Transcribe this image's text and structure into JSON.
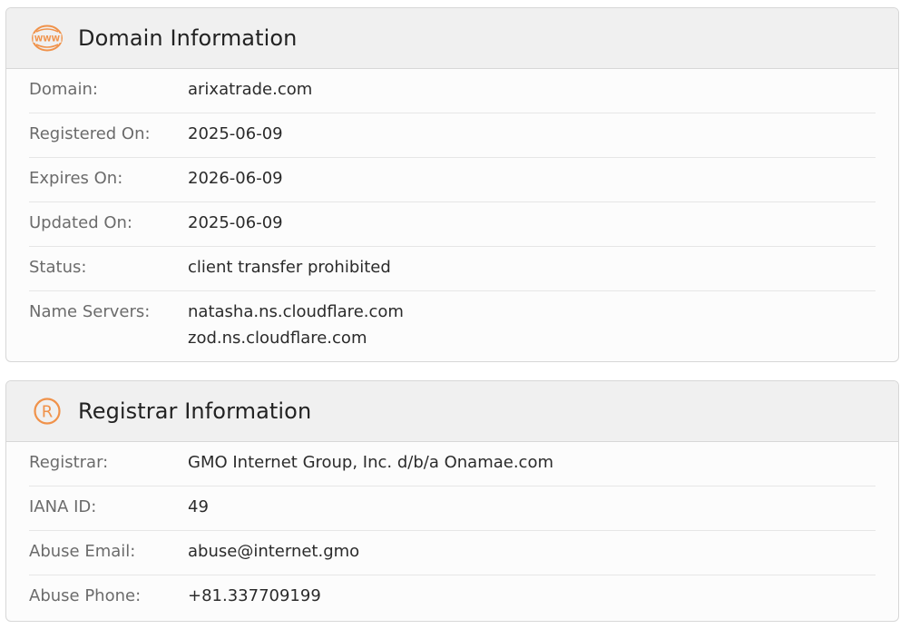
{
  "domain_section": {
    "title": "Domain Information",
    "icon": "www-globe-icon",
    "rows": [
      {
        "label": "Domain:",
        "value": "arixatrade.com"
      },
      {
        "label": "Registered On:",
        "value": "2025-06-09"
      },
      {
        "label": "Expires On:",
        "value": "2026-06-09"
      },
      {
        "label": "Updated On:",
        "value": "2025-06-09"
      },
      {
        "label": "Status:",
        "value": "client transfer prohibited"
      },
      {
        "label": "Name Servers:",
        "values": [
          "natasha.ns.cloudflare.com",
          "zod.ns.cloudflare.com"
        ]
      }
    ]
  },
  "registrar_section": {
    "title": "Registrar Information",
    "icon": "registered-trademark-icon",
    "rows": [
      {
        "label": "Registrar:",
        "value": "GMO Internet Group, Inc. d/b/a Onamae.com"
      },
      {
        "label": "IANA ID:",
        "value": "49"
      },
      {
        "label": "Abuse Email:",
        "value": "abuse@internet.gmo"
      },
      {
        "label": "Abuse Phone:",
        "value": "+81.337709199"
      }
    ]
  },
  "colors": {
    "accent": "#f0924a",
    "header_bg": "#f0f0f0",
    "label_text": "#6b6b6b",
    "value_text": "#2b2b2b"
  }
}
